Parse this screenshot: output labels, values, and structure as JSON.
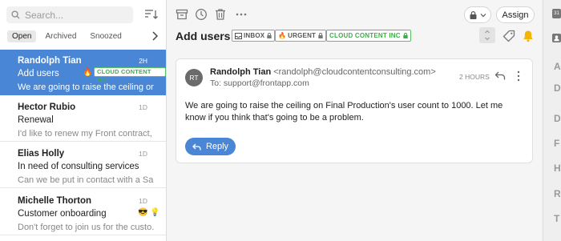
{
  "search": {
    "placeholder": "Search..."
  },
  "filters": [
    "Open",
    "Archived",
    "Snoozed"
  ],
  "conversations": [
    {
      "sender": "Randolph Tian",
      "time": "2H",
      "subject": "Add users",
      "preview": "We are going to raise the ceiling on",
      "tag": "CLOUD CONTENT INC",
      "emoji": "🔥"
    },
    {
      "sender": "Hector Rubio",
      "time": "1D",
      "subject": "Renewal",
      "preview": "I'd like to renew my Front contract, ..."
    },
    {
      "sender": "Elias Holly",
      "time": "1D",
      "subject": "In need of consulting services",
      "preview": "Can we be put in contact with a Sal..."
    },
    {
      "sender": "Michelle Thorton",
      "time": "1D",
      "subject": "Customer onboarding",
      "preview": "Don't forget to join us for the custo...",
      "emoji": "😎",
      "emoji2": "💡"
    }
  ],
  "toolbar": {
    "assign_label": "Assign"
  },
  "conversation": {
    "title": "Add users",
    "tags": [
      "INBOX",
      "URGENT",
      "CLOUD CONTENT INC"
    ]
  },
  "message": {
    "avatar_initials": "RT",
    "from_name": "Randolph Tian",
    "from_address": "<randolph@cloudcontentconsulting.com>",
    "to": "To: support@frontapp.com",
    "time": "2 HOURS",
    "body": "We are going to raise the ceiling on Final Production's user count to 1000. Let me know if you think that's going to be a problem.",
    "reply_label": "Reply"
  },
  "right_sidebar": {
    "calendar_day": "31",
    "letters": [
      "A",
      "D",
      "D",
      "F",
      "H",
      "R",
      "T"
    ]
  },
  "colors": {
    "accent": "#4a86d6",
    "tag_green": "#3fae49",
    "bell": "#f5b400"
  }
}
